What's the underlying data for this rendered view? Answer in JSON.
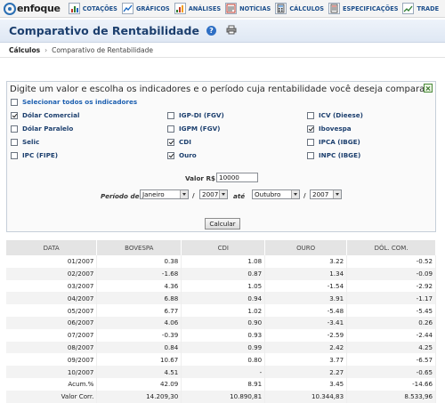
{
  "nav": {
    "logo": "enfoque",
    "items": [
      {
        "label": "COTAÇÕES",
        "icon": "quotes-icon"
      },
      {
        "label": "GRÁFICOS",
        "icon": "charts-icon"
      },
      {
        "label": "ANÁLISES",
        "icon": "analysis-icon"
      },
      {
        "label": "NOTÍCIAS",
        "icon": "news-icon"
      },
      {
        "label": "CÁLCULOS",
        "icon": "calculator-icon"
      },
      {
        "label": "ESPECIFICAÇÕES",
        "icon": "specs-icon"
      },
      {
        "label": "TRADE",
        "icon": "trade-icon"
      }
    ]
  },
  "page": {
    "title": "Comparativo de Rentabilidade",
    "help": "?",
    "breadcrumb": [
      "Cálculos",
      "Comparativo de Rentabilidade"
    ]
  },
  "form": {
    "heading": "Digite um valor e escolha os indicadores e o período cuja rentabilidade você deseja comparar:",
    "select_all": "Selecionar todos os indicadores",
    "indicators": [
      {
        "label": "Dólar Comercial",
        "checked": true
      },
      {
        "label": "IGP-DI (FGV)",
        "checked": false
      },
      {
        "label": "ICV (Dieese)",
        "checked": false
      },
      {
        "label": "Dólar Paralelo",
        "checked": false
      },
      {
        "label": "IGPM (FGV)",
        "checked": false
      },
      {
        "label": "Ibovespa",
        "checked": true
      },
      {
        "label": "Selic",
        "checked": false
      },
      {
        "label": "CDI",
        "checked": true
      },
      {
        "label": "IPCA (IBGE)",
        "checked": false
      },
      {
        "label": "IPC (FIPE)",
        "checked": false
      },
      {
        "label": "Ouro",
        "checked": true
      },
      {
        "label": "INPC (IBGE)",
        "checked": false
      }
    ],
    "valor_label": "Valor R$",
    "valor": "10000",
    "periodo_label": "Período de",
    "mes_inicio": "Janeiro",
    "ano_inicio": "2007",
    "ate_label": "até",
    "mes_fim": "Outubro",
    "ano_fim": "2007",
    "slash": "/",
    "button": "Calcular"
  },
  "table": {
    "headers": [
      "DATA",
      "BOVESPA",
      "CDI",
      "OURO",
      "DÓL. COM."
    ],
    "rows": [
      [
        "01/2007",
        "0.38",
        "1.08",
        "3.22",
        "-0.52"
      ],
      [
        "02/2007",
        "-1.68",
        "0.87",
        "1.34",
        "-0.09"
      ],
      [
        "03/2007",
        "4.36",
        "1.05",
        "-1.54",
        "-2.92"
      ],
      [
        "04/2007",
        "6.88",
        "0.94",
        "3.91",
        "-1.17"
      ],
      [
        "05/2007",
        "6.77",
        "1.02",
        "-5.48",
        "-5.45"
      ],
      [
        "06/2007",
        "4.06",
        "0.90",
        "-3.41",
        "0.26"
      ],
      [
        "07/2007",
        "-0.39",
        "0.93",
        "-2.59",
        "-2.44"
      ],
      [
        "08/2007",
        "0.84",
        "0.99",
        "2.42",
        "4.25"
      ],
      [
        "09/2007",
        "10.67",
        "0.80",
        "3.77",
        "-6.57"
      ],
      [
        "10/2007",
        "4.51",
        "-",
        "2.27",
        "-0.65"
      ],
      [
        "Acum.%",
        "42.09",
        "8.91",
        "3.45",
        "-14.66"
      ],
      [
        "Valor Corr.",
        "14.209,30",
        "10.890,81",
        "10.344,83",
        "8.533,96"
      ]
    ]
  }
}
